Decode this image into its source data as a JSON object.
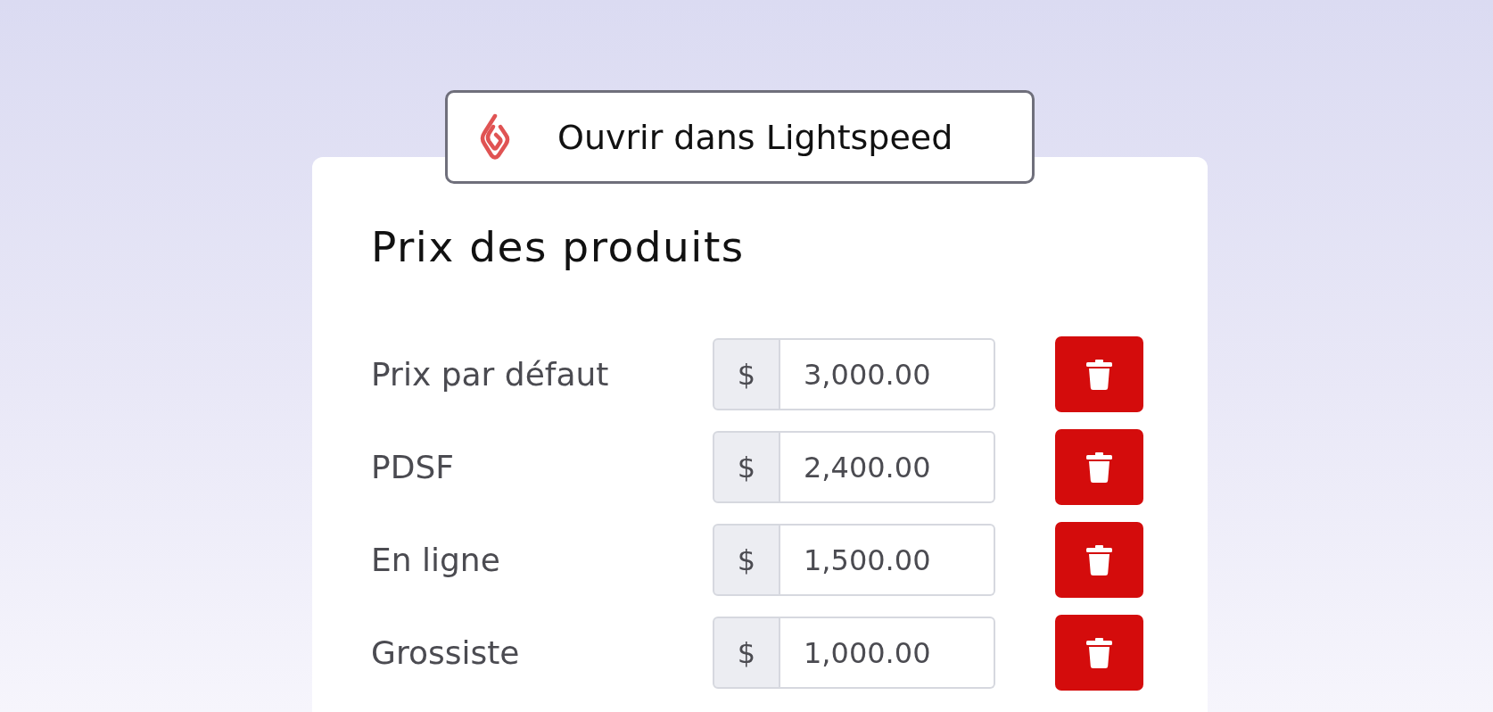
{
  "open_button": {
    "label": "Ouvrir dans Lightspeed"
  },
  "card": {
    "title": "Prix des produits",
    "prices": [
      {
        "label": "Prix par défaut",
        "currency": "$",
        "value": "3,000.00"
      },
      {
        "label": "PDSF",
        "currency": "$",
        "value": "2,400.00"
      },
      {
        "label": "En ligne",
        "currency": "$",
        "value": "1,500.00"
      },
      {
        "label": "Grossiste",
        "currency": "$",
        "value": "1,000.00"
      }
    ]
  }
}
